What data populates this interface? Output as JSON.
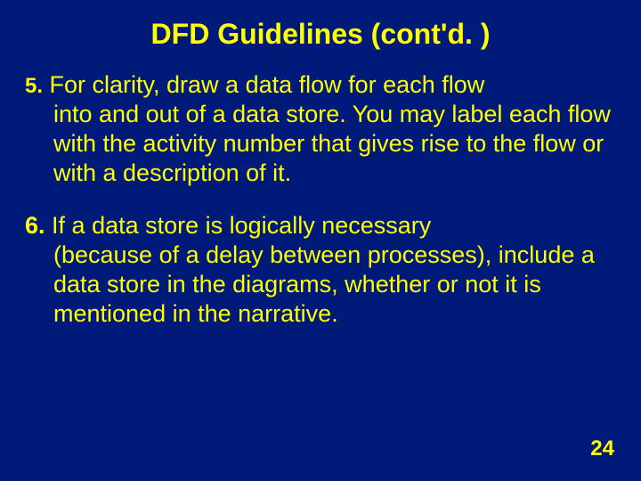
{
  "title": "DFD Guidelines (cont'd. )",
  "items": [
    {
      "marker": "5.",
      "first": "For clarity, draw a data flow for each flow",
      "rest": "into and out of a data store. You may label each flow with the activity number that gives rise  to the flow or with a description of it."
    },
    {
      "marker": "6.",
      "first": "If a data store is logically necessary",
      "rest": "(because of a delay between processes), include a data store in the diagrams, whether or not it is mentioned in the narrative."
    }
  ],
  "page_number": "24"
}
